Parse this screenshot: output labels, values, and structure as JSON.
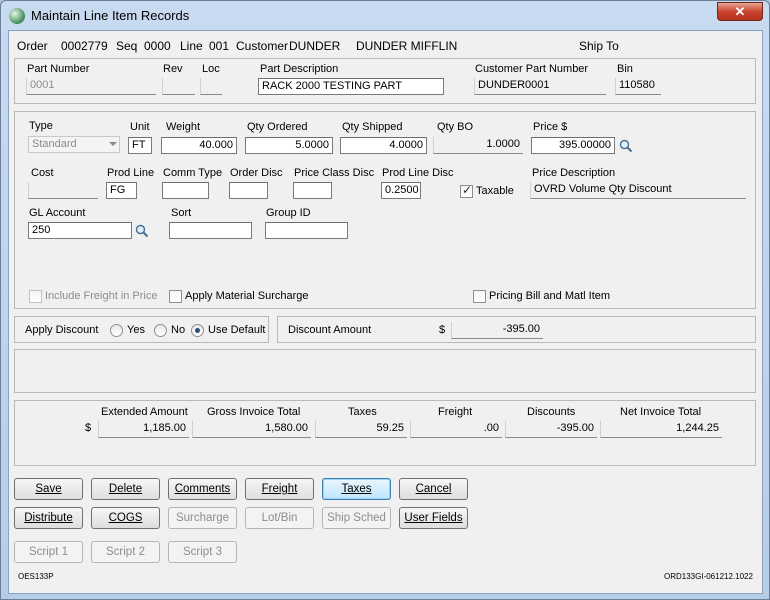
{
  "window": {
    "title": "Maintain Line Item Records",
    "close_glyph": "✕"
  },
  "header": {
    "order_label": "Order",
    "order_value": "0002779",
    "seq_label": "Seq",
    "seq_value": "0000",
    "line_label": "Line",
    "line_value": "001",
    "customer_label": "Customer",
    "customer_code": "DUNDER",
    "customer_name": "DUNDER MIFFLIN",
    "ship_to_label": "Ship To"
  },
  "part": {
    "part_number_label": "Part Number",
    "part_number_value": "0001",
    "rev_label": "Rev",
    "rev_value": "",
    "loc_label": "Loc",
    "loc_value": "",
    "part_desc_label": "Part Description",
    "part_desc_value": "RACK 2000 TESTING PART",
    "cust_part_label": "Customer Part Number",
    "cust_part_value": "DUNDER0001",
    "bin_label": "Bin",
    "bin_value": "110580"
  },
  "details": {
    "type_label": "Type",
    "type_value": "Standard",
    "unit_label": "Unit",
    "unit_value": "FT",
    "weight_label": "Weight",
    "weight_value": "40.000",
    "qty_ordered_label": "Qty Ordered",
    "qty_ordered_value": "5.0000",
    "qty_shipped_label": "Qty Shipped",
    "qty_shipped_value": "4.0000",
    "qty_bo_label": "Qty BO",
    "qty_bo_value": "1.0000",
    "price_label": "Price  $",
    "price_value": "395.00000",
    "cost_label": "Cost",
    "cost_value": "",
    "prod_line_label": "Prod Line",
    "prod_line_value": "FG",
    "comm_type_label": "Comm Type",
    "comm_type_value": "",
    "order_disc_label": "Order Disc",
    "order_disc_value": "",
    "price_class_disc_label": "Price Class Disc",
    "price_class_disc_value": "",
    "prod_line_disc_label": "Prod Line Disc",
    "prod_line_disc_value": "0.2500",
    "taxable_label": "Taxable",
    "price_desc_label": "Price Description",
    "price_desc_value": "OVRD Volume Qty Discount",
    "gl_account_label": "GL Account",
    "gl_account_value": "250",
    "sort_label": "Sort",
    "sort_value": "",
    "group_id_label": "Group ID",
    "group_id_value": "",
    "include_freight_label": "Include Freight in Price",
    "apply_surcharge_label": "Apply Material Surcharge",
    "pricing_bill_label": "Pricing Bill and Matl Item"
  },
  "discount": {
    "apply_label": "Apply Discount",
    "yes_label": "Yes",
    "no_label": "No",
    "default_label": "Use Default",
    "amount_label": "Discount Amount",
    "currency": "$",
    "amount_value": "-395.00"
  },
  "totals": {
    "currency": "$",
    "extended_label": "Extended Amount",
    "extended_value": "1,185.00",
    "gross_label": "Gross Invoice Total",
    "gross_value": "1,580.00",
    "taxes_label": "Taxes",
    "taxes_value": "59.25",
    "freight_label": "Freight",
    "freight_value": ".00",
    "discounts_label": "Discounts",
    "discounts_value": "-395.00",
    "net_label": "Net Invoice Total",
    "net_value": "1,244.25"
  },
  "buttons": {
    "save": "Save",
    "delete": "Delete",
    "comments": "Comments",
    "freight": "Freight",
    "taxes": "Taxes",
    "cancel": "Cancel",
    "distribute": "Distribute",
    "cogs": "COGS",
    "surcharge": "Surcharge",
    "lot_bin": "Lot/Bin",
    "ship_sched": "Ship Sched",
    "user_fields": "User Fields",
    "script1": "Script 1",
    "script2": "Script 2",
    "script3": "Script 3"
  },
  "footer": {
    "left_code": "OES133P",
    "right_code": "ORD133GI-061212.1022"
  }
}
